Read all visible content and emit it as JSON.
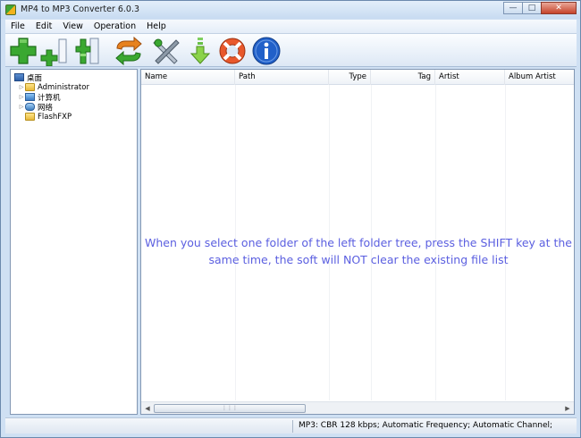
{
  "window": {
    "title": "MP4 to MP3 Converter 6.0.3"
  },
  "menu": [
    "File",
    "Edit",
    "View",
    "Operation",
    "Help"
  ],
  "toolbar": {
    "buttons": [
      {
        "name": "add-files-button",
        "icon": "add-plus-icon"
      },
      {
        "name": "add-folder-button",
        "icon": "add-small-plus-icon"
      },
      {
        "name": "add-list-button",
        "icon": "add-columns-icon"
      },
      {
        "name": "convert-button",
        "icon": "convert-arrows-icon"
      },
      {
        "name": "settings-button",
        "icon": "tools-icon"
      },
      {
        "name": "download-button",
        "icon": "download-arrow-icon"
      },
      {
        "name": "help-button",
        "icon": "lifebuoy-icon"
      },
      {
        "name": "about-button",
        "icon": "info-icon"
      }
    ]
  },
  "tree": [
    {
      "label": "桌面",
      "icon": "desktop-icon"
    },
    {
      "label": "Administrator",
      "icon": "folder-icon"
    },
    {
      "label": "计算机",
      "icon": "computer-icon"
    },
    {
      "label": "网络",
      "icon": "network-icon"
    },
    {
      "label": "FlashFXP",
      "icon": "folder-icon"
    }
  ],
  "list": {
    "columns": [
      "Name",
      "Path",
      "Type",
      "Tag",
      "Artist",
      "Album Artist"
    ],
    "hint": "When you select one folder of the left folder tree, press the SHIFT key at the same time, the soft will NOT clear the existing file list"
  },
  "status": {
    "text": "MP3:  CBR 128 kbps; Automatic Frequency; Automatic Channel;"
  },
  "colors": {
    "hint": "#5b5fe0",
    "accent_green": "#3aa831",
    "accent_blue": "#2160c9"
  }
}
